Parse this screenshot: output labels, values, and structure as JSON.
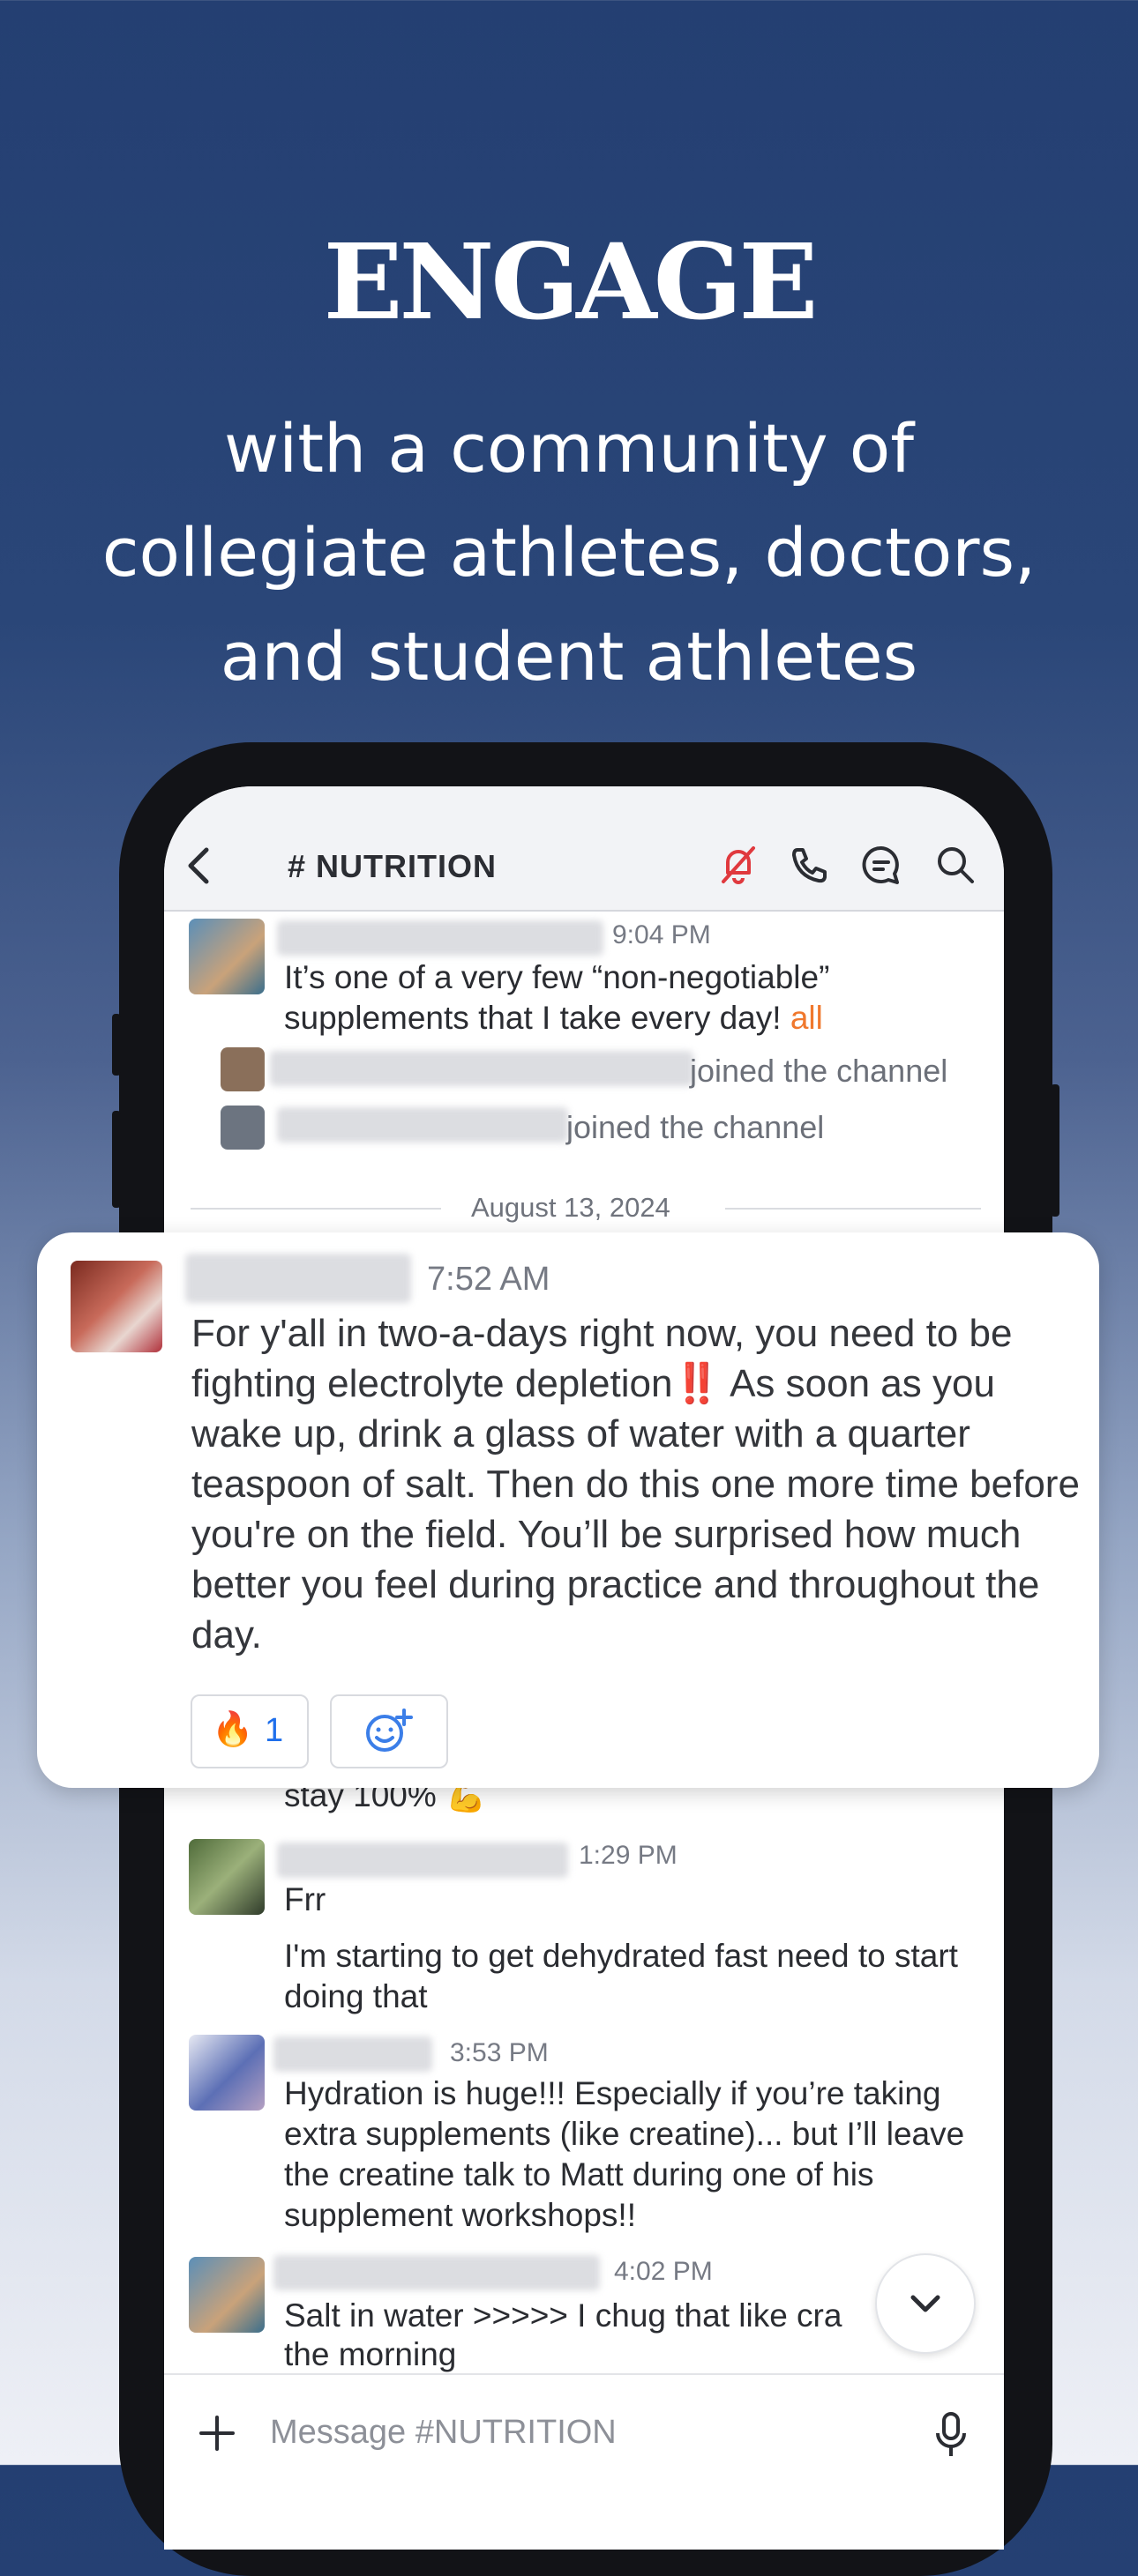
{
  "headline": "ENGAGE",
  "subline": "with a community of collegiate athletes, doctors, and student athletes",
  "header": {
    "channel": "# NUTRITION"
  },
  "messages": {
    "m1": {
      "time": "9:04 PM",
      "text": "It’s one of a very few “non-negotiable” supplements that I take every day!",
      "mention": "all"
    },
    "join1": "joined the channel",
    "join2": "joined the channel",
    "date": "August 13, 2024",
    "m2_partial": "stay 100%",
    "m3": {
      "time": "1:29 PM",
      "line1": "Frr",
      "line2": "I'm starting to get dehydrated fast need to start doing that"
    },
    "m4": {
      "time": "3:53 PM",
      "text": "Hydration is huge!!! Especially if you’re taking extra supplements (like creatine)... but I’ll leave the creatine talk to Matt during one of his supplement workshops!!"
    },
    "m5": {
      "time": "4:02 PM",
      "text": "Salt in water >>>>> I chug that like cra",
      "text2": "the morning"
    }
  },
  "featured": {
    "time": "7:52 AM",
    "text_a": "For y'all in two-a-days right now, you need to be fighting electrolyte depletion",
    "emoji": "‼️",
    "text_b": " As soon as you wake up, drink a glass of water with a quarter teaspoon of salt. Then do this one more time before you're on the field. You’ll be surprised how much better you feel during practice and throughout the day.",
    "reaction": {
      "emoji": "🔥",
      "count": "1"
    }
  },
  "composer": {
    "placeholder": "Message #NUTRITION"
  },
  "colors": {
    "mute": "#e0393e",
    "mention": "#f0782d",
    "accent": "#243f72"
  },
  "icons": [
    "back-icon",
    "mute-bell-icon",
    "phone-icon",
    "thread-icon",
    "search-icon",
    "add-reaction-icon",
    "chevron-down-icon",
    "plus-icon",
    "mic-icon"
  ]
}
